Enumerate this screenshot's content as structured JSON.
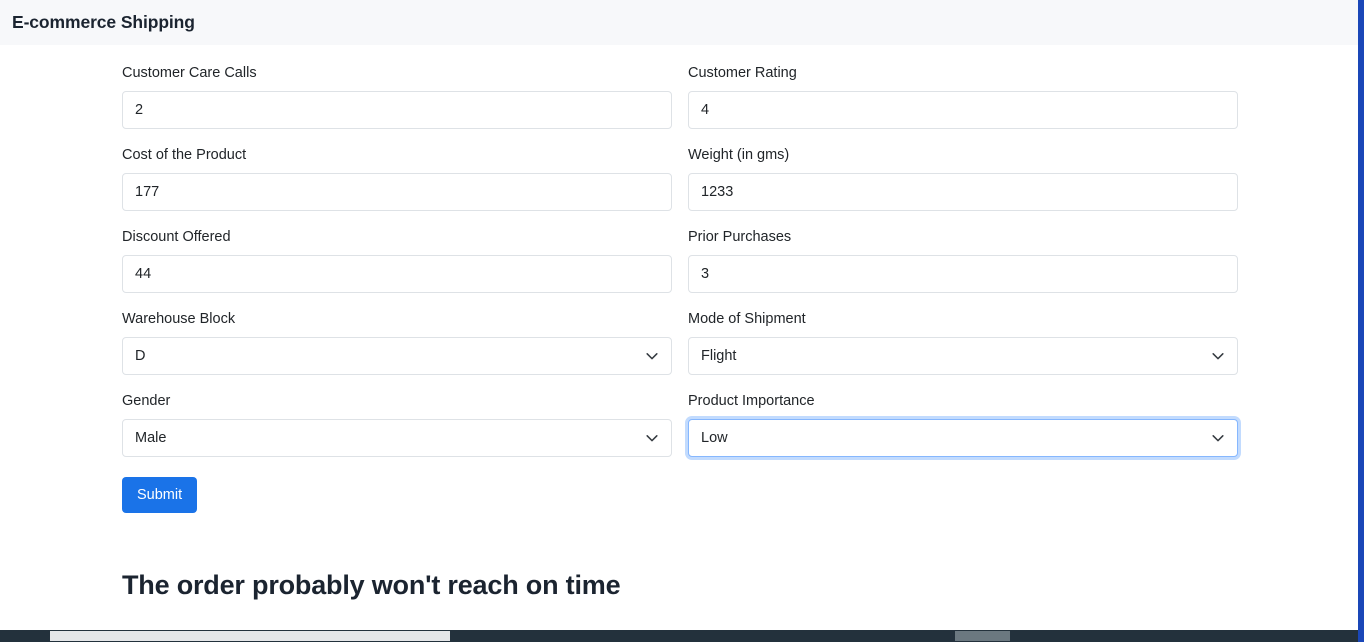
{
  "header": {
    "title": "E-commerce Shipping"
  },
  "form": {
    "fields": [
      {
        "label": "Customer Care Calls",
        "value": "2",
        "type": "text",
        "focused": false,
        "name": "customer-care-calls"
      },
      {
        "label": "Customer Rating",
        "value": "4",
        "type": "text",
        "focused": false,
        "name": "customer-rating"
      },
      {
        "label": "Cost of the Product",
        "value": "177",
        "type": "text",
        "focused": false,
        "name": "cost-of-the-product"
      },
      {
        "label": "Weight (in gms)",
        "value": "1233",
        "type": "text",
        "focused": false,
        "name": "weight-in-gms"
      },
      {
        "label": "Discount Offered",
        "value": "44",
        "type": "text",
        "focused": false,
        "name": "discount-offered"
      },
      {
        "label": "Prior Purchases",
        "value": "3",
        "type": "text",
        "focused": false,
        "name": "prior-purchases"
      },
      {
        "label": "Warehouse Block",
        "value": "D",
        "type": "select",
        "focused": false,
        "name": "warehouse-block"
      },
      {
        "label": "Mode of Shipment",
        "value": "Flight",
        "type": "select",
        "focused": false,
        "name": "mode-of-shipment"
      },
      {
        "label": "Gender",
        "value": "Male",
        "type": "select",
        "focused": false,
        "name": "gender"
      },
      {
        "label": "Product Importance",
        "value": "Low",
        "type": "select",
        "focused": true,
        "name": "product-importance"
      }
    ],
    "submit_label": "Submit"
  },
  "result": {
    "heading": "The order probably won't reach on time"
  },
  "icons": {
    "chevron": "chevron-down-icon"
  },
  "colors": {
    "accent": "#1a73e8",
    "header_bg": "#f7f8fa",
    "focus_ring": "#86b7fe",
    "border": "#dee2e6",
    "scrollbar_track": "#23313c",
    "scrollbar_accent": "#1a47b8"
  }
}
